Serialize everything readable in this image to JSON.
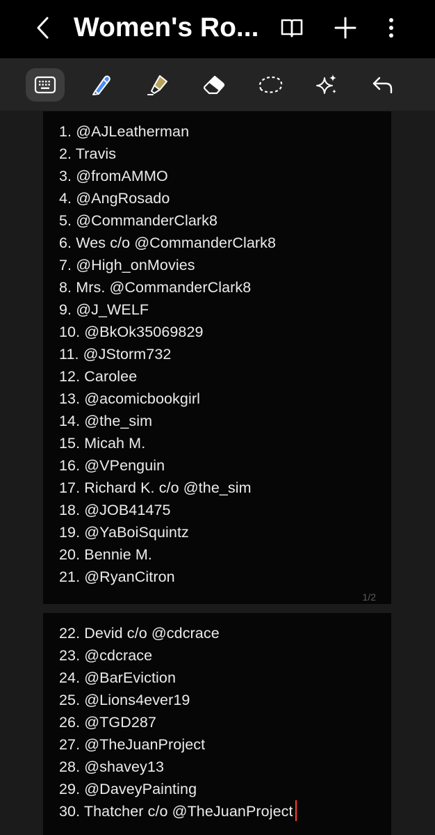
{
  "header": {
    "title": "Women's Ro...",
    "icons": [
      "back-chevron-icon",
      "book-view-icon",
      "plus-icon",
      "more-vert-icon"
    ]
  },
  "toolbar": {
    "tools": [
      {
        "icon": "keyboard-icon",
        "active": true
      },
      {
        "icon": "pen-icon",
        "color": "#4a8ff7"
      },
      {
        "icon": "highlighter-icon",
        "color": "#b7a35a"
      },
      {
        "icon": "eraser-icon"
      },
      {
        "icon": "lasso-select-icon"
      },
      {
        "icon": "sparkle-ai-icon"
      },
      {
        "icon": "undo-icon"
      }
    ]
  },
  "pages": [
    {
      "lines": [
        "1. @AJLeatherman",
        "2. Travis",
        "3. @fromAMMO",
        "4. @AngRosado",
        "5. @CommanderClark8",
        "6. Wes c/o @CommanderClark8",
        "7. @High_onMovies",
        "8. Mrs. @CommanderClark8",
        "9. @J_WELF",
        "10. @BkOk35069829",
        "11. @JStorm732",
        "12. Carolee",
        "13. @acomicbookgirl",
        "14. @the_sim",
        "15. Micah M.",
        "16. @VPenguin",
        "17. Richard K. c/o @the_sim",
        "18. @JOB41475",
        "19. @YaBoiSquintz",
        "20. Bennie M.",
        "21. @RyanCitron"
      ],
      "page_label": "1/2"
    },
    {
      "lines": [
        "22. Devid c/o @cdcrace",
        "23. @cdcrace",
        "24. @BarEviction",
        "25. @Lions4ever19",
        "26. @TGD287",
        "27. @TheJuanProject",
        "28. @shavey13",
        "29. @DaveyPainting",
        "30. Thatcher c/o @TheJuanProject"
      ]
    }
  ],
  "colors": {
    "cursor": "#ff3b2f",
    "background": "#1b1b1b",
    "page": "#060606"
  }
}
